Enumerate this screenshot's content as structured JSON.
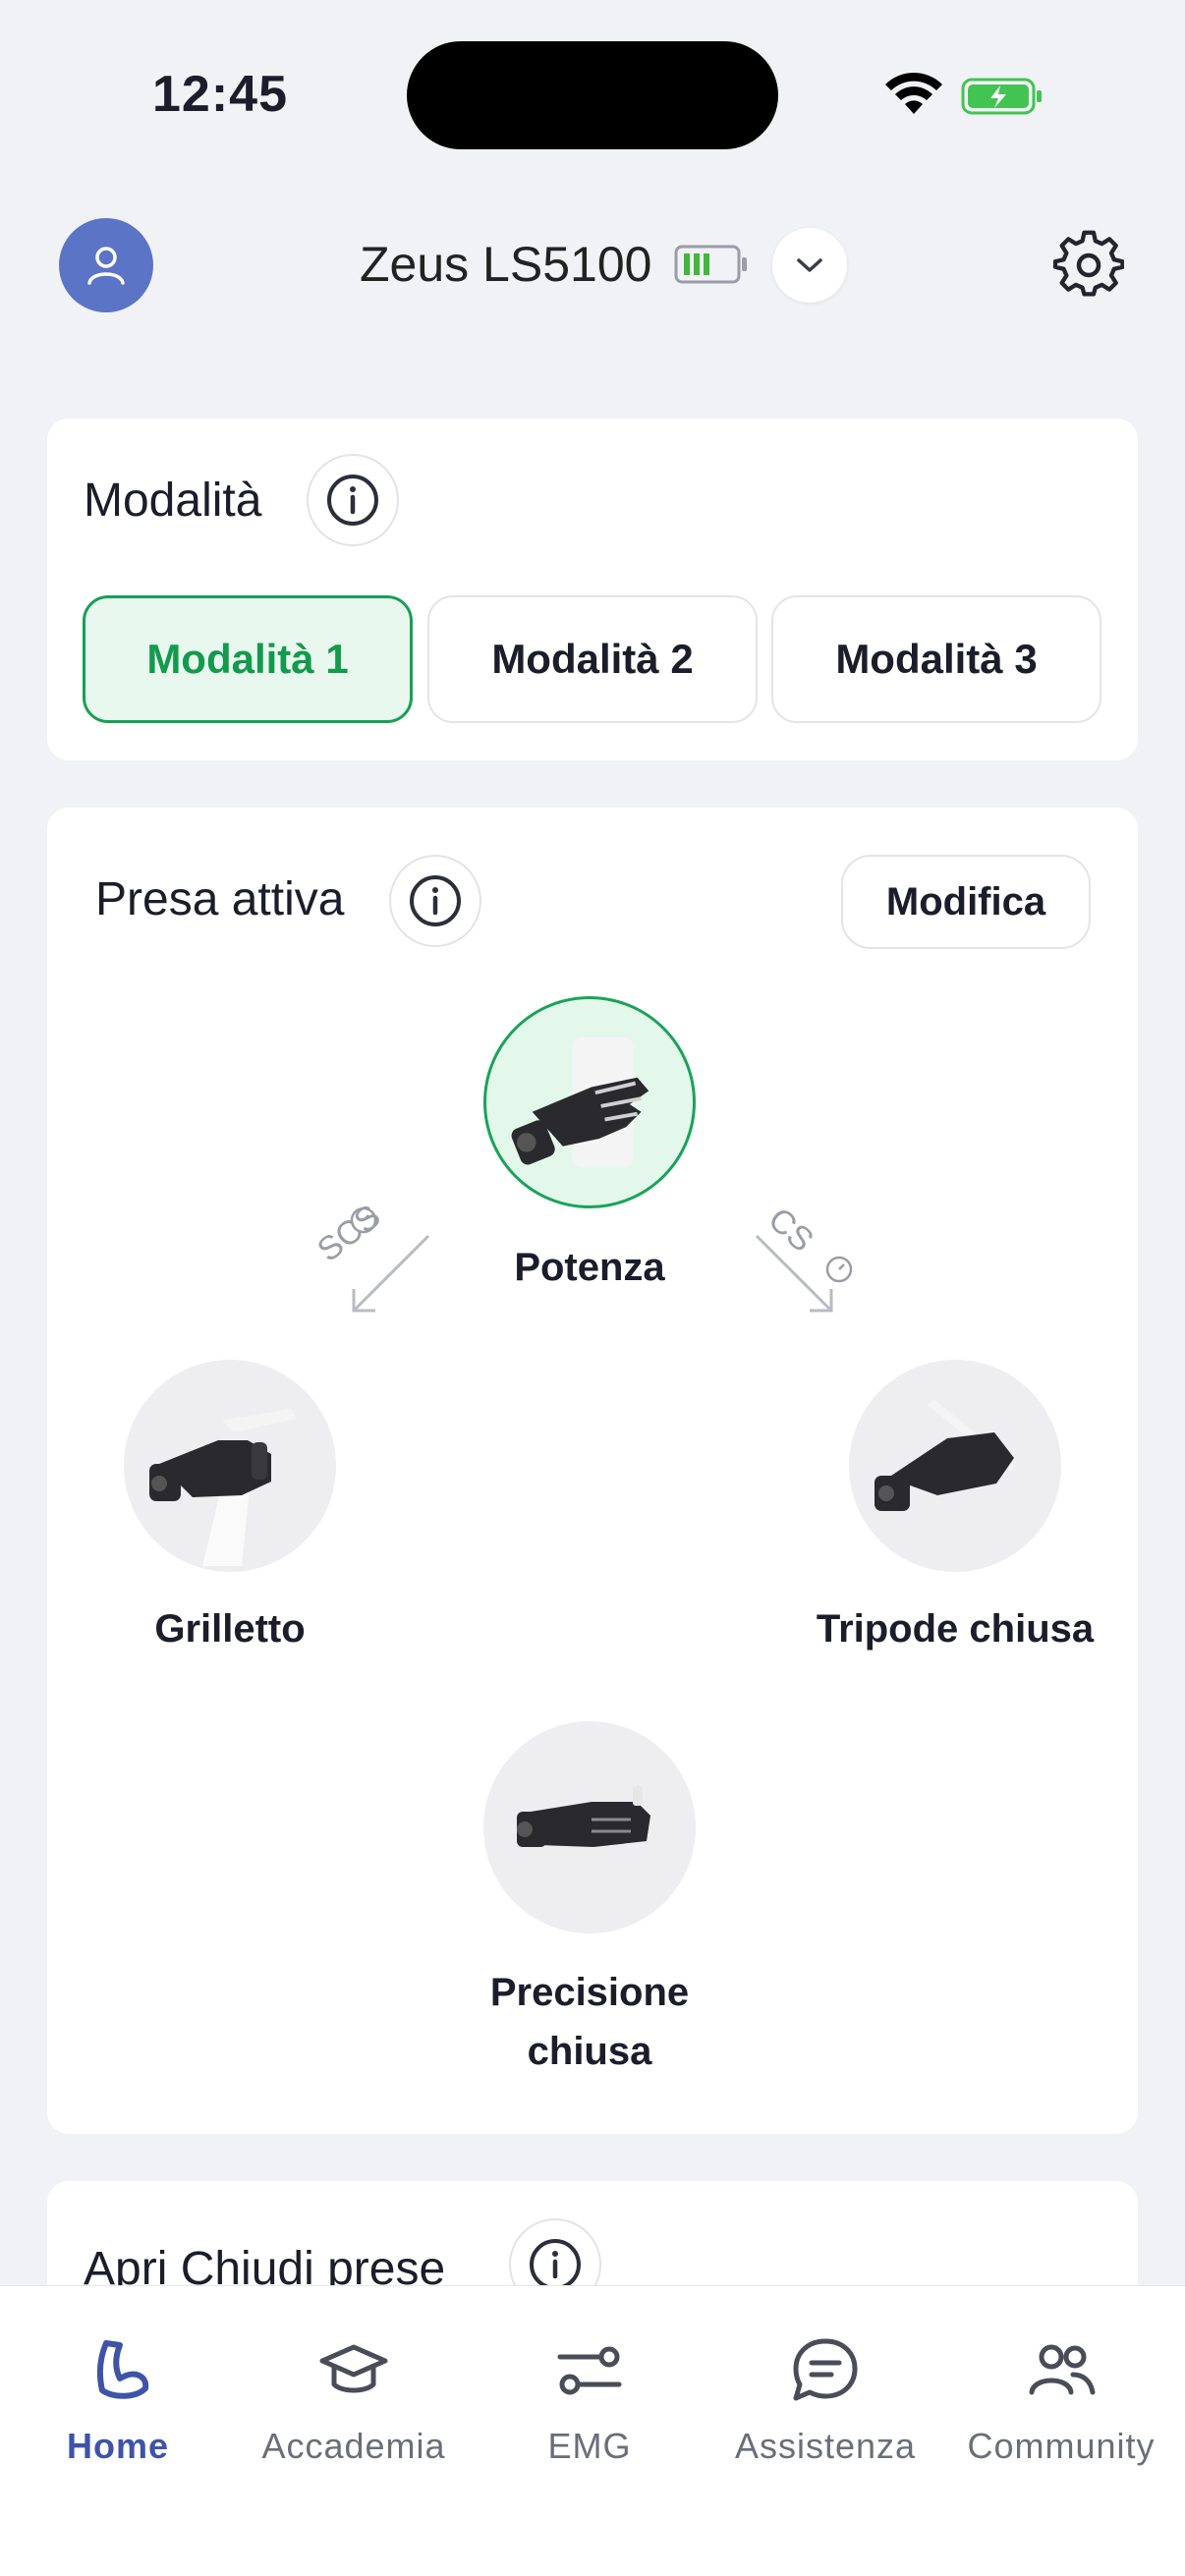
{
  "status_bar": {
    "time": "12:45"
  },
  "header": {
    "device_name": "Zeus LS5100"
  },
  "modes": {
    "title": "Modalità",
    "buttons": [
      {
        "label": "Modalità 1",
        "active": true
      },
      {
        "label": "Modalità 2",
        "active": false
      },
      {
        "label": "Modalità 3",
        "active": false
      }
    ]
  },
  "presa": {
    "title": "Presa attiva",
    "edit_label": "Modifica",
    "grips": [
      {
        "label": "Potenza",
        "active": true
      },
      {
        "label": "Grilletto",
        "active": false
      },
      {
        "label": "Tripode chiusa",
        "active": false
      },
      {
        "label": "Precisione chiusa",
        "active": false
      }
    ],
    "transitions": [
      {
        "label": "SCS"
      },
      {
        "label": "CS"
      }
    ]
  },
  "apri": {
    "title": "Apri Chiudi prese"
  },
  "bottom_nav": {
    "items": [
      {
        "label": "Home",
        "icon": "arm-icon",
        "active": true
      },
      {
        "label": "Accademia",
        "icon": "graduation-cap-icon",
        "active": false
      },
      {
        "label": "EMG",
        "icon": "sliders-icon",
        "active": false
      },
      {
        "label": "Assistenza",
        "icon": "chat-bubble-icon",
        "active": false
      },
      {
        "label": "Community",
        "icon": "users-icon",
        "active": false
      }
    ]
  },
  "colors": {
    "accent_green": "#17a055",
    "accent_blue": "#3e53a9",
    "avatar_blue": "#5b74c6",
    "background": "#f1f2f6"
  }
}
